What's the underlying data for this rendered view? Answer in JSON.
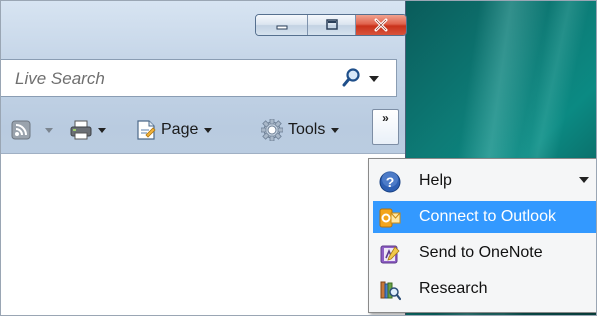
{
  "search": {
    "placeholder": "Live Search"
  },
  "commandbar": {
    "page_label": "Page",
    "tools_label": "Tools",
    "overflow_label": "»"
  },
  "menu": {
    "items": [
      {
        "label": "Help",
        "icon": "help-icon",
        "has_submenu": true,
        "highlighted": false
      },
      {
        "label": "Connect to Outlook",
        "icon": "outlook-icon",
        "has_submenu": false,
        "highlighted": true
      },
      {
        "label": "Send to OneNote",
        "icon": "onenote-icon",
        "has_submenu": false,
        "highlighted": false
      },
      {
        "label": "Research",
        "icon": "research-icon",
        "has_submenu": false,
        "highlighted": false
      }
    ]
  },
  "colors": {
    "highlight": "#3399ff",
    "close_button": "#d9432c",
    "desktop": "#0b7b76"
  }
}
